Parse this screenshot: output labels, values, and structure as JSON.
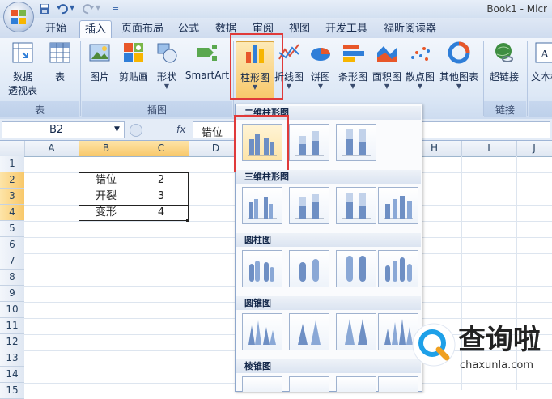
{
  "window": {
    "title": "Book1 - Micr"
  },
  "qat": {
    "icons": [
      "office-logo",
      "save-icon",
      "undo-icon",
      "redo-icon",
      "customize-icon"
    ]
  },
  "tabs": [
    "开始",
    "插入",
    "页面布局",
    "公式",
    "数据",
    "审阅",
    "视图",
    "开发工具",
    "福昕阅读器"
  ],
  "active_tab": "插入",
  "ribbon": {
    "pivot_label1": "数据",
    "pivot_label2": "透视表",
    "table_label": "表",
    "picture_label": "图片",
    "clipart_label": "剪贴画",
    "shapes_label": "形状",
    "smartart_label": "SmartArt",
    "column_label": "柱形图",
    "line_label": "折线图",
    "pie_label": "饼图",
    "bar_label": "条形图",
    "area_label": "面积图",
    "scatter_label": "散点图",
    "other_label": "其他图表",
    "hyperlink_label": "超链接",
    "textbox_label": "文本框",
    "group_tables": "表",
    "group_illustrations": "插图",
    "group_links": "链接"
  },
  "formula_bar": {
    "name_box": "B2",
    "fx": "fx",
    "value": "错位"
  },
  "columns": [
    "A",
    "B",
    "C",
    "D",
    "E",
    "F",
    "G",
    "H",
    "I",
    "J"
  ],
  "rows": [
    "1",
    "2",
    "3",
    "4",
    "5",
    "6",
    "7",
    "8",
    "9",
    "10",
    "11",
    "12",
    "13",
    "14",
    "15"
  ],
  "cells": [
    {
      "b": "错位",
      "c": "2"
    },
    {
      "b": "开裂",
      "c": "3"
    },
    {
      "b": "变形",
      "c": "4"
    }
  ],
  "gallery": {
    "section_2d": "二维柱形图",
    "section_3d": "三维柱形图",
    "section_cylinder": "圆柱图",
    "section_cone": "圆锥图",
    "section_pyramid": "棱锥图"
  },
  "watermark": {
    "name": "查询啦",
    "domain": "chaxunla.com"
  },
  "colors": {
    "accent_red": "#e03a3a",
    "selected_header": "#f8c86a",
    "ribbon": "#dde8f6"
  }
}
